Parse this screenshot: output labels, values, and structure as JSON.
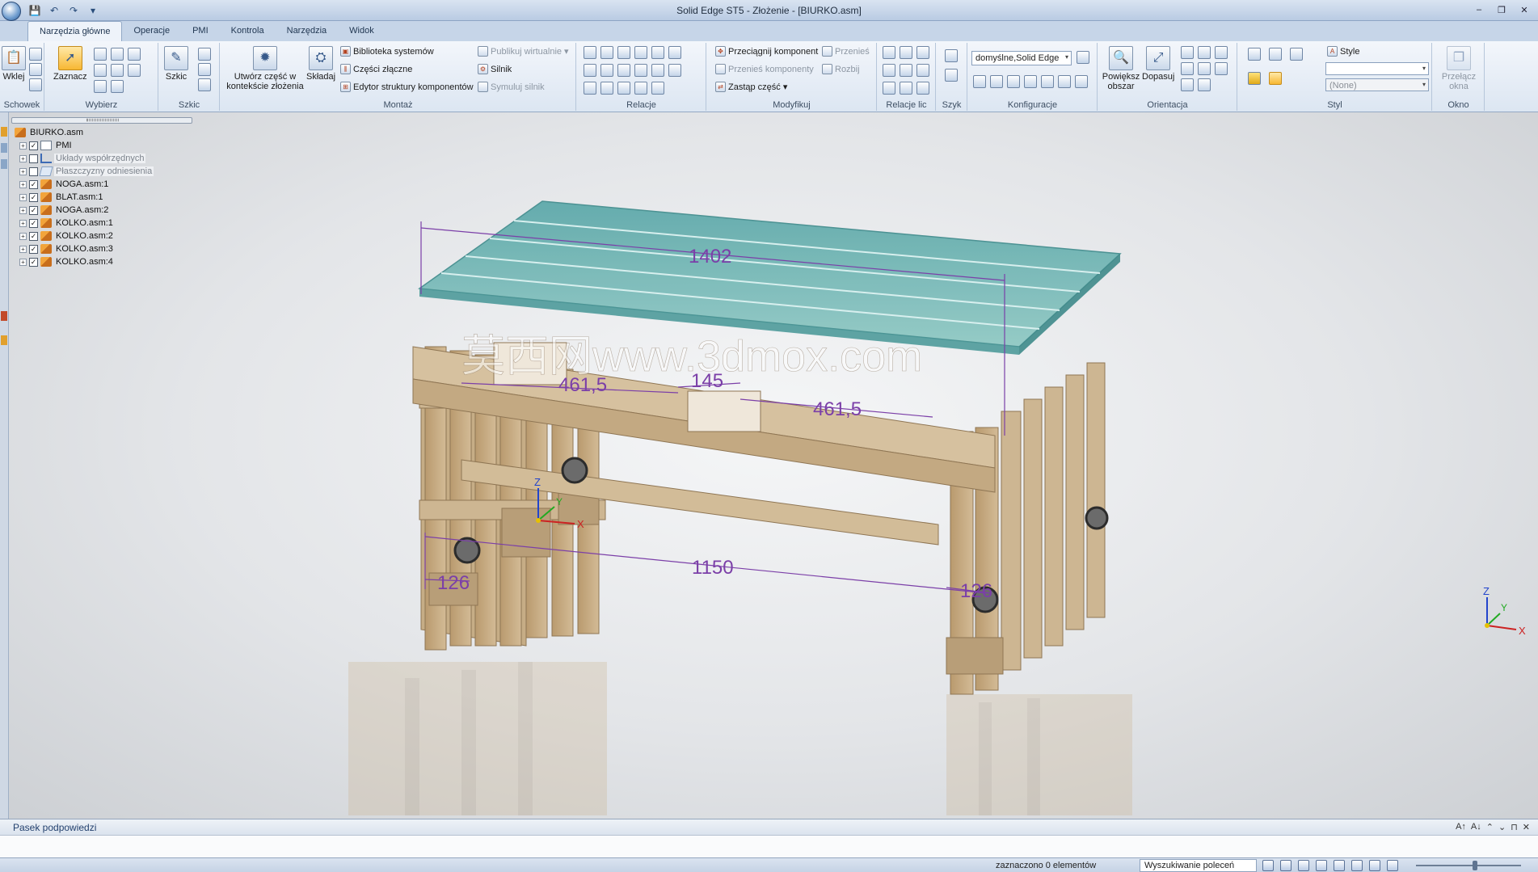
{
  "window": {
    "title": "Solid Edge ST5 - Złożenie - [BIURKO.asm]",
    "controls": [
      "–",
      "❐",
      "✕"
    ]
  },
  "quick_access": [
    "💾",
    "↶",
    "↷",
    "▾"
  ],
  "ribbon": {
    "tabs": [
      "Narzędzia główne",
      "Operacje",
      "PMI",
      "Kontrola",
      "Narzędzia",
      "Widok"
    ],
    "active_tab": "Narzędzia główne",
    "groups": {
      "schowek": {
        "label": "Schowek",
        "paste": "Wklej"
      },
      "wybierz": {
        "label": "Wybierz",
        "select": "Zaznacz"
      },
      "szkic": {
        "label": "Szkic",
        "sketch": "Szkic"
      },
      "montaz": {
        "label": "Montaż",
        "create_part": "Utwórz część w kontekście złożenia",
        "assemble": "Składaj",
        "systems_library": "Biblioteka systemów",
        "joined_parts": "Części złączne",
        "component_editor": "Edytor struktury komponentów",
        "publish_virtual": "Publikuj wirtualnie",
        "motor": "Silnik",
        "simulate_motor": "Symuluj silnik"
      },
      "relacje": {
        "label": "Relacje"
      },
      "modyfikuj": {
        "label": "Modyfikuj",
        "drag_component": "Przeciągnij komponent",
        "move": "Przenieś",
        "move_components": "Przenieś komponenty",
        "explode": "Rozbij",
        "replace_part": "Zastąp część"
      },
      "relacje_lic": {
        "label": "Relacje lic"
      },
      "szyk": {
        "label": "Szyk"
      },
      "konfiguracje": {
        "label": "Konfiguracje",
        "config_value": "domyślne,Solid Edge"
      },
      "orientacja": {
        "label": "Orientacja",
        "zoom_area": "Powiększ obszar",
        "fit": "Dopasuj"
      },
      "styl": {
        "label": "Styl",
        "style_label": "Style",
        "style_value": "(None)"
      },
      "okno": {
        "label": "Okno",
        "switch_window": "Przełącz okna"
      }
    }
  },
  "tree": {
    "root": "BIURKO.asm",
    "items": [
      {
        "label": "PMI",
        "checked": true,
        "icon": "pmi-icon"
      },
      {
        "label": "Układy współrzędnych",
        "checked": false,
        "icon": "coordinate-system-icon"
      },
      {
        "label": "Płaszczyzny odniesienia",
        "checked": false,
        "icon": "reference-plane-icon"
      },
      {
        "label": "NOGA.asm:1",
        "checked": true,
        "icon": "assembly-icon"
      },
      {
        "label": "BLAT.asm:1",
        "checked": true,
        "icon": "assembly-icon"
      },
      {
        "label": "NOGA.asm:2",
        "checked": true,
        "icon": "assembly-icon"
      },
      {
        "label": "KOLKO.asm:1",
        "checked": true,
        "icon": "assembly-icon"
      },
      {
        "label": "KOLKO.asm:2",
        "checked": true,
        "icon": "assembly-icon"
      },
      {
        "label": "KOLKO.asm:3",
        "checked": true,
        "icon": "assembly-icon"
      },
      {
        "label": "KOLKO.asm:4",
        "checked": true,
        "icon": "assembly-icon"
      }
    ]
  },
  "model": {
    "dimensions": {
      "top_length": "1402",
      "left_span": "461,5",
      "center_span": "145",
      "right_span": "461,5",
      "bottom_length": "1150",
      "left_offset": "126",
      "right_offset": "126"
    },
    "watermark": "莫西网www.3dmox.com",
    "axis_labels": {
      "x": "X",
      "y": "Y",
      "z": "Z"
    },
    "colors": {
      "wood": "#c9b08a",
      "glass": "#6fb4b4",
      "dimension": "#7b3fa8"
    }
  },
  "prompt_bar": {
    "title": "Pasek podpowiedzi",
    "tools": [
      "A↑",
      "A↓",
      "⌃",
      "⌄",
      "⊓",
      "✕"
    ]
  },
  "status": {
    "selection": "zaznaczono 0 elementów",
    "command_search": "Wyszukiwanie poleceń"
  }
}
